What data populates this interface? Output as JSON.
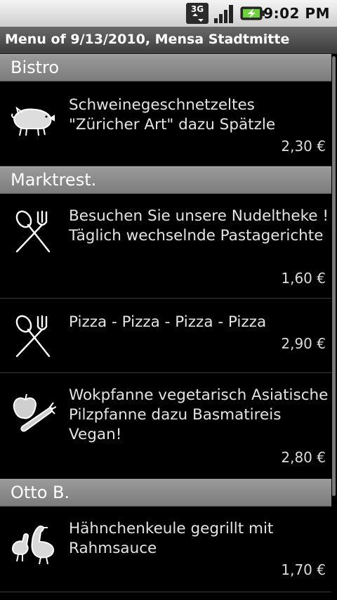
{
  "status_bar": {
    "network_label": "3G",
    "time": "9:02 PM",
    "icons": [
      "3g-data-icon",
      "signal-strength-icon",
      "battery-charging-icon"
    ]
  },
  "title_bar": {
    "title": "Menu of 9/13/2010, Mensa Stadtmitte"
  },
  "sections": [
    {
      "name": "Bistro",
      "items": [
        {
          "icon": "pig-icon",
          "text": "Schweinegeschnetzeltes \"Züricher Art\" dazu Spätzle",
          "price": "2,30 €"
        }
      ]
    },
    {
      "name": "Marktrest.",
      "items": [
        {
          "icon": "cutlery-icon",
          "text": "Besuchen Sie unsere Nudeltheke ! Täglich wechselnde Pastagerichte",
          "price": "1,60 €"
        },
        {
          "icon": "cutlery-icon",
          "text": "Pizza - Pizza - Pizza - Pizza",
          "price": "2,90 €"
        },
        {
          "icon": "vegetable-icon",
          "text": "Wokpfanne vegetarisch Asiatische Pilzpfanne dazu Basmatireis Vegan!",
          "price": "2,80 €"
        }
      ]
    },
    {
      "name": "Otto B.",
      "items": [
        {
          "icon": "poultry-icon",
          "text": "Hähnchenkeule gegrillt  mit Rahmsauce",
          "price": "1,70 €"
        }
      ]
    }
  ],
  "colors": {
    "status_bar_bg": "#dcdcdc",
    "title_bar_bg": "#4a4a4a",
    "section_header_bg": "#8a8a8a",
    "list_bg": "#000000",
    "text": "#e4e4e4"
  }
}
